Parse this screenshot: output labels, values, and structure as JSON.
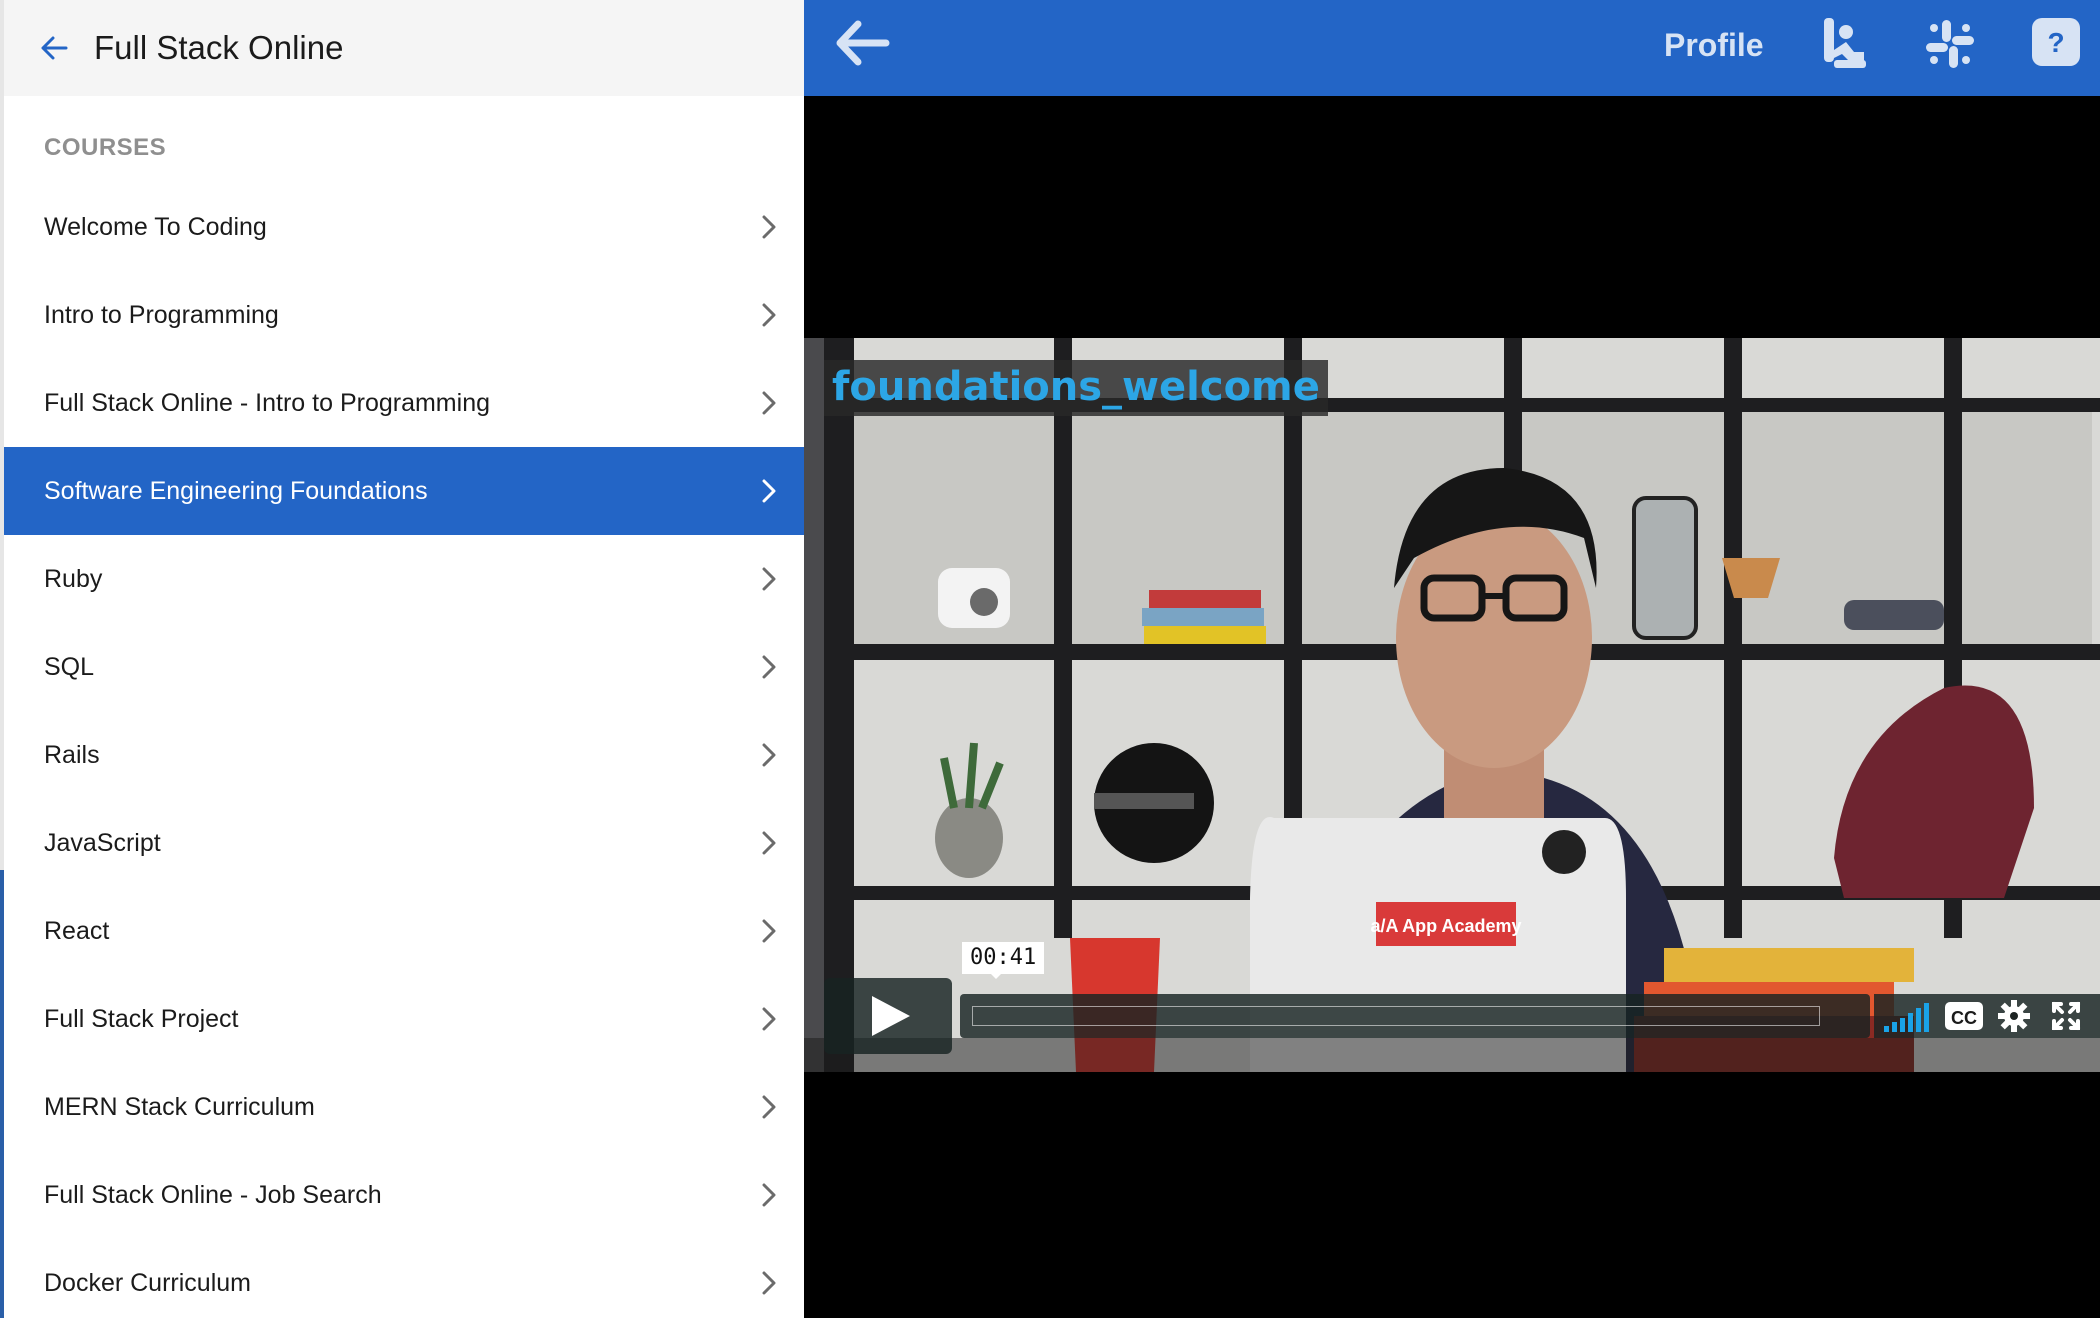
{
  "drawer": {
    "title": "Full Stack Online",
    "section_label": "COURSES",
    "courses": [
      {
        "label": "Welcome To Coding",
        "active": false
      },
      {
        "label": "Intro to Programming",
        "active": false
      },
      {
        "label": "Full Stack Online - Intro to Programming",
        "active": false
      },
      {
        "label": "Software Engineering Foundations",
        "active": true
      },
      {
        "label": "Ruby",
        "active": false
      },
      {
        "label": "SQL",
        "active": false
      },
      {
        "label": "Rails",
        "active": false
      },
      {
        "label": "JavaScript",
        "active": false
      },
      {
        "label": "React",
        "active": false
      },
      {
        "label": "Full Stack Project",
        "active": false
      },
      {
        "label": "MERN Stack Curriculum",
        "active": false
      },
      {
        "label": "Full Stack Online - Job Search",
        "active": false
      },
      {
        "label": "Docker Curriculum",
        "active": false
      }
    ]
  },
  "topbar": {
    "profile_label": "Profile",
    "icons": [
      "back-arrow-icon",
      "progress-figure-icon",
      "slack-icon",
      "help-icon"
    ]
  },
  "video": {
    "title_overlay": "foundations_welcome",
    "time_tooltip": "00:41",
    "laptop_sticker": "App Academy",
    "controls": [
      "play-icon",
      "volume-bars-icon",
      "closed-captions-icon",
      "settings-gear-icon",
      "fullscreen-icon"
    ]
  },
  "colors": {
    "accent_blue": "#2365c6",
    "title_cyan": "#2ca6e6",
    "volume_blue": "#1aa3e8"
  }
}
